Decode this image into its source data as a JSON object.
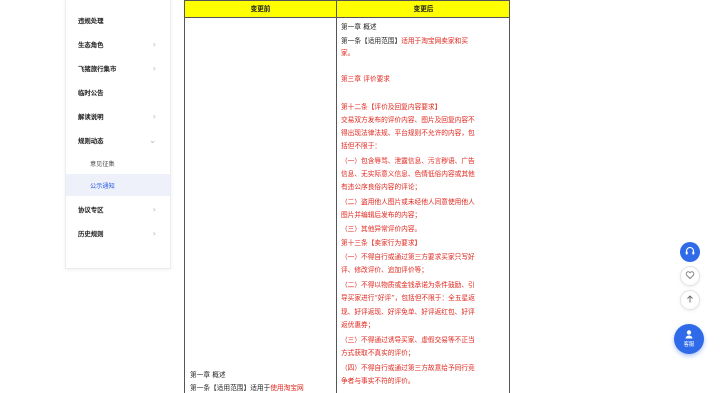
{
  "sidebar": {
    "items": [
      {
        "label": "违规处理",
        "chevron": ""
      },
      {
        "label": "生态角色",
        "chevron": "›"
      },
      {
        "label": "飞猪旅行集市",
        "chevron": "›"
      },
      {
        "label": "临时公告",
        "chevron": ""
      },
      {
        "label": "解读说明",
        "chevron": "›"
      },
      {
        "label": "规则动态",
        "chevron": "⌄"
      }
    ],
    "subitems": [
      {
        "label": "意见征集"
      },
      {
        "label": "公示通知"
      }
    ],
    "items_after": [
      {
        "label": "协议专区",
        "chevron": "›"
      },
      {
        "label": "历史规则",
        "chevron": "›"
      }
    ]
  },
  "table": {
    "header_before": "变更前",
    "header_after": "变更后",
    "after_lines": [
      "第一章 概述",
      "第一条【适用范围】",
      "适用于淘宝网卖家和买",
      "家。",
      "第三章 评价要求",
      "第十二条【评价及回复内容要求】",
      "交易双方发布的评价内容、图片及回复内容不",
      "得出现法律法规、平台规则不允许的内容，包",
      "括但不限于：",
      "（一）包含辱骂、泄露信息、污言秽语、广告",
      "信息、无实际意义信息、色情低俗内容或其他",
      "有违公序良俗内容的评论；",
      "（二）盗用他人图片或未经他人同意使用他人",
      "图片并编辑后发布的内容；",
      "（三）其他异常评价内容。",
      "第十三条【卖家行为要求】",
      "（一）不得自行或通过第三方要求买家只写好",
      "评、修改评价、追加评价等；",
      "（二）不得以物质或金钱承诺为条件鼓励、引",
      "导买家进行“好评”，包括但不限于：全五星返",
      "现、好评返现、好评免单、好评返红包、好评",
      "返优惠券；",
      "（三）不得通过诱导买家、虚假交易等不正当",
      "方式获取不真实的评价；",
      "（四）不得自行或通过第三方故意给予同行竞",
      "争者与事实不符的评价。"
    ],
    "before_lines": [
      "第一章 概述",
      "第一条【适用范围】",
      "适用于",
      "使用淘宝网"
    ]
  },
  "floating": {
    "headset_icon": "headset-icon",
    "heart_icon": "heart-icon",
    "top_icon": "arrow-up-icon",
    "service_label": "客服"
  },
  "colors": {
    "accent": "#2f6be8",
    "header_bg": "#ffff00",
    "change_red": "#e0261d",
    "active_nav": "#2f5ee8"
  }
}
